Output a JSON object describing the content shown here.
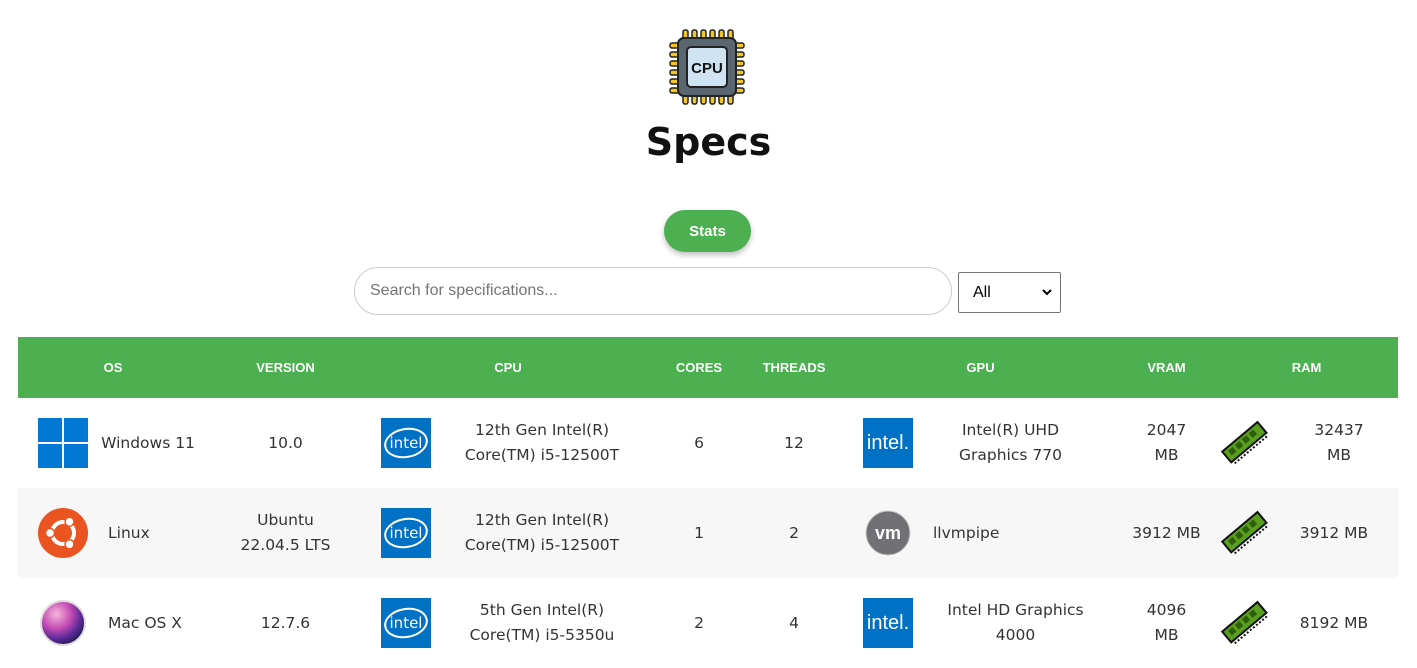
{
  "header": {
    "logo_text": "CPU",
    "title": "Specs"
  },
  "toolbar": {
    "stats_label": "Stats",
    "search_placeholder": "Search for specifications...",
    "filter_selected": "All"
  },
  "table": {
    "columns": [
      "OS",
      "VERSION",
      "CPU",
      "CORES",
      "THREADS",
      "GPU",
      "VRAM",
      "RAM"
    ],
    "rows": [
      {
        "os_icon": "windows-logo-icon",
        "os_name": "Windows 11",
        "version": "10.0",
        "cpu_icon": "intel-logo-icon",
        "cpu": "12th Gen Intel(R) Core(TM) i5-12500T",
        "cores": "6",
        "threads": "12",
        "gpu_icon": "intel-logo-icon",
        "gpu": "Intel(R) UHD Graphics 770",
        "vram": "2047 MB",
        "ram_icon": "ram-module-icon",
        "ram": "32437 MB"
      },
      {
        "os_icon": "ubuntu-logo-icon",
        "os_name": "Linux",
        "version": "Ubuntu 22.04.5 LTS",
        "cpu_icon": "intel-logo-icon",
        "cpu": "12th Gen Intel(R) Core(TM) i5-12500T",
        "cores": "1",
        "threads": "2",
        "gpu_icon": "vmware-logo-icon",
        "gpu": "llvmpipe",
        "vram": "3912 MB",
        "ram_icon": "ram-module-icon",
        "ram": "3912 MB"
      },
      {
        "os_icon": "macos-logo-icon",
        "os_name": "Mac OS X",
        "version": "12.7.6",
        "cpu_icon": "intel-logo-icon",
        "cpu": "5th Gen Intel(R) Core(TM) i5-5350u",
        "cores": "2",
        "threads": "4",
        "gpu_icon": "intel-logo-icon",
        "gpu": "Intel HD Graphics 4000",
        "vram": "4096 MB",
        "ram_icon": "ram-module-icon",
        "ram": "8192 MB"
      }
    ]
  },
  "colors": {
    "accent": "#4caf50",
    "header_text": "#ffffff",
    "intel_blue": "#0071c5",
    "windows_blue": "#0078d4",
    "ubuntu_orange": "#e95420",
    "vmware_gray": "#717074",
    "ram_green": "#5a9e1e"
  }
}
